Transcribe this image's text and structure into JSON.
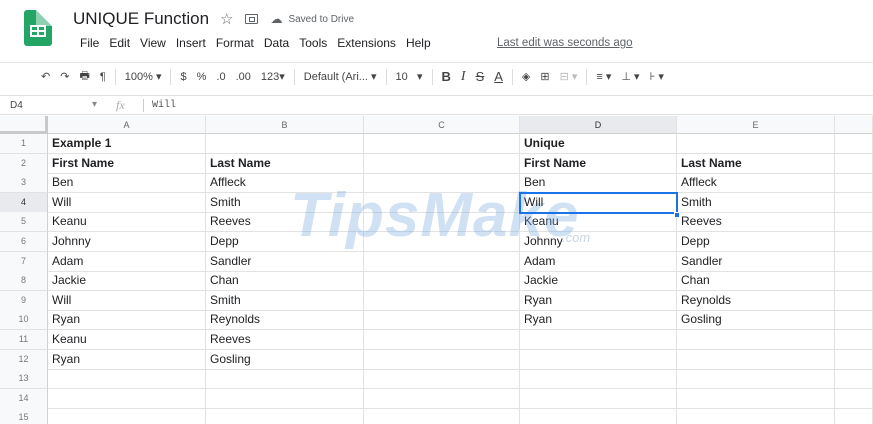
{
  "header": {
    "title": "UNIQUE Function",
    "saved_status": "Saved to Drive",
    "last_edit": "Last edit was seconds ago",
    "logo_color": "#23a566"
  },
  "menu": [
    "File",
    "Edit",
    "View",
    "Insert",
    "Format",
    "Data",
    "Tools",
    "Extensions",
    "Help"
  ],
  "toolbar": {
    "undo_icon": "↶",
    "redo_icon": "↷",
    "print_icon": "🖶",
    "paint_format_icon": "¶",
    "zoom": "100%",
    "currency": "$",
    "percent": "%",
    "decrease_decimals": ".0",
    "increase_decimals": ".00",
    "more_formats": "123",
    "font": "Default (Ari...",
    "font_size": "10",
    "bold": "B",
    "italic": "I",
    "strikethrough": "S",
    "text_color": "A",
    "dropdown_arrow": "▾"
  },
  "formula_bar": {
    "cell_ref": "D4",
    "fx": "fx",
    "value": "Will"
  },
  "columns": [
    "A",
    "B",
    "C",
    "D",
    "E"
  ],
  "rows": [
    "1",
    "2",
    "3",
    "4",
    "5",
    "6",
    "7",
    "8",
    "9",
    "10",
    "11",
    "12",
    "13",
    "14",
    "15"
  ],
  "cells": {
    "A": [
      "Example 1",
      "First Name",
      "Ben",
      "Will",
      "Keanu",
      "Johnny",
      "Adam",
      "Jackie",
      "Will",
      "Ryan",
      "Keanu",
      "Ryan",
      "",
      "",
      ""
    ],
    "B": [
      "",
      "Last Name",
      "Affleck",
      "Smith",
      "Reeves",
      "Depp",
      "Sandler",
      "Chan",
      "Smith",
      "Reynolds",
      "Reeves",
      "Gosling",
      "",
      "",
      ""
    ],
    "C": [
      "",
      "",
      "",
      "",
      "",
      "",
      "",
      "",
      "",
      "",
      "",
      "",
      "",
      "",
      ""
    ],
    "D": [
      "Unique",
      "First Name",
      "Ben",
      "Will",
      "Keanu",
      "Johnny",
      "Adam",
      "Jackie",
      "Ryan",
      "Ryan",
      "",
      "",
      "",
      "",
      ""
    ],
    "E": [
      "",
      "Last Name",
      "Affleck",
      "Smith",
      "Reeves",
      "Depp",
      "Sandler",
      "Chan",
      "Reynolds",
      "Gosling",
      "",
      "",
      "",
      "",
      ""
    ]
  },
  "selection": {
    "column": "D",
    "row": "4",
    "color": "#1a73e8"
  },
  "watermark": {
    "main": "TipsMake",
    "small": ".com"
  }
}
